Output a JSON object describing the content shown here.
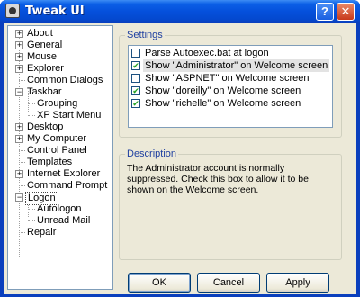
{
  "window": {
    "title": "Tweak UI",
    "help_label": "?",
    "close_label": "✕"
  },
  "tree": {
    "items": [
      {
        "label": "About",
        "expander": "+"
      },
      {
        "label": "General",
        "expander": "+"
      },
      {
        "label": "Mouse",
        "expander": "+"
      },
      {
        "label": "Explorer",
        "expander": "+"
      },
      {
        "label": "Common Dialogs"
      },
      {
        "label": "Taskbar",
        "expander": "−"
      },
      {
        "label": "Grouping"
      },
      {
        "label": "XP Start Menu"
      },
      {
        "label": "Desktop",
        "expander": "+"
      },
      {
        "label": "My Computer",
        "expander": "+"
      },
      {
        "label": "Control Panel"
      },
      {
        "label": "Templates"
      },
      {
        "label": "Internet Explorer",
        "expander": "+"
      },
      {
        "label": "Command Prompt"
      },
      {
        "label": "Logon",
        "expander": "−"
      },
      {
        "label": "Autologon"
      },
      {
        "label": "Unread Mail"
      },
      {
        "label": "Repair"
      }
    ]
  },
  "settings": {
    "title": "Settings",
    "items": [
      {
        "label": "Parse Autoexec.bat at logon",
        "checked": false
      },
      {
        "label": "Show \"Administrator\" on Welcome screen",
        "checked": true
      },
      {
        "label": "Show \"ASPNET\" on Welcome screen",
        "checked": false
      },
      {
        "label": "Show \"doreilly\" on Welcome screen",
        "checked": true
      },
      {
        "label": "Show \"richelle\" on Welcome screen",
        "checked": true
      }
    ]
  },
  "description": {
    "title": "Description",
    "text": "The Administrator account is normally suppressed.  Check this box to allow it to be shown on the Welcome screen."
  },
  "buttons": {
    "ok": "OK",
    "cancel": "Cancel",
    "apply": "Apply"
  }
}
